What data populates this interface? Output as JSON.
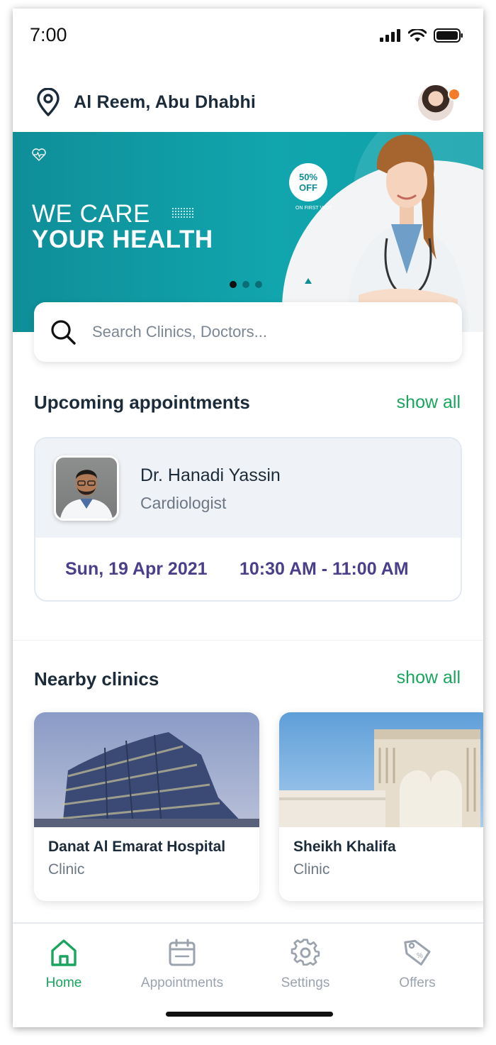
{
  "status_bar": {
    "time": "7:00"
  },
  "header": {
    "location": "Al Reem, Abu Dhabhi"
  },
  "banner": {
    "line1": "WE CARE",
    "line2": "YOUR HEALTH",
    "offer_percent": "50%",
    "offer_word": "OFF",
    "offer_sub": "ON FIRST VISIT",
    "active_slide": 1,
    "slide_count": 3
  },
  "search": {
    "placeholder": "Search Clinics, Doctors..."
  },
  "appointments": {
    "title": "Upcoming appointments",
    "show_all": "show all",
    "items": [
      {
        "doctor": "Dr. Hanadi Yassin",
        "specialty": "Cardiologist",
        "date": "Sun, 19 Apr 2021",
        "time": "10:30 AM - 11:00 AM"
      }
    ]
  },
  "clinics": {
    "title": "Nearby clinics",
    "show_all": "show all",
    "items": [
      {
        "name": "Danat Al Emarat Hospital",
        "type": "Clinic"
      },
      {
        "name": "Sheikh Khalifa",
        "type": "Clinic"
      }
    ]
  },
  "tabs": [
    {
      "label": "Home",
      "icon": "home-icon",
      "active": true
    },
    {
      "label": "Appointments",
      "icon": "calendar-icon",
      "active": false
    },
    {
      "label": "Settings",
      "icon": "gear-icon",
      "active": false
    },
    {
      "label": "Offers",
      "icon": "tag-icon",
      "active": false
    }
  ],
  "colors": {
    "accent": "#1aa55e",
    "banner": "#11a5ad",
    "appointment_text": "#4a3f8a",
    "notification": "#f47b2a"
  }
}
